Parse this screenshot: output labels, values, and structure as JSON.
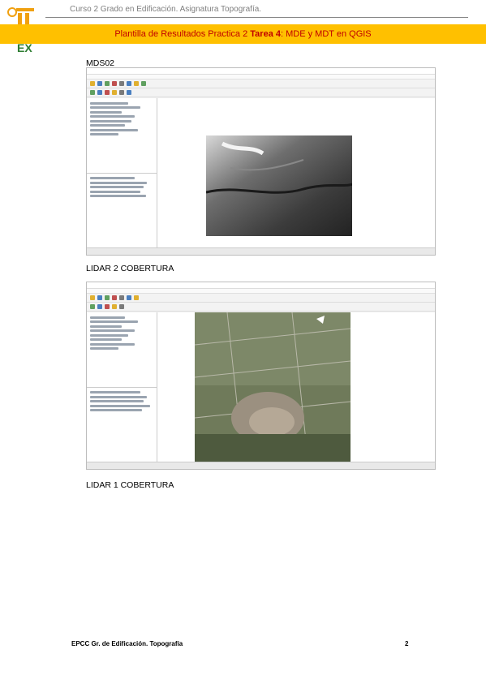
{
  "header": {
    "course": "Curso 2 Grado en Edificación. Asignatura Topografía.",
    "bar_prefix": "Plantilla de Resultados Practica 2",
    "bar_task": "Tarea 4",
    "bar_suffix": ": MDE y MDT en QGIS",
    "logo_text": "EX"
  },
  "sections": [
    {
      "label": "MDS02"
    },
    {
      "label": "LIDAR 2 COBERTURA"
    },
    {
      "label": "LIDAR 1 COBERTURA"
    }
  ],
  "footer": {
    "left": "EPCC Gr. de Edificación. Topografía",
    "page": "2"
  },
  "colors": {
    "header_bar": "#ffc000",
    "header_text": "#c00000",
    "logo_orange": "#f0a010",
    "logo_green": "#2e7d32"
  }
}
